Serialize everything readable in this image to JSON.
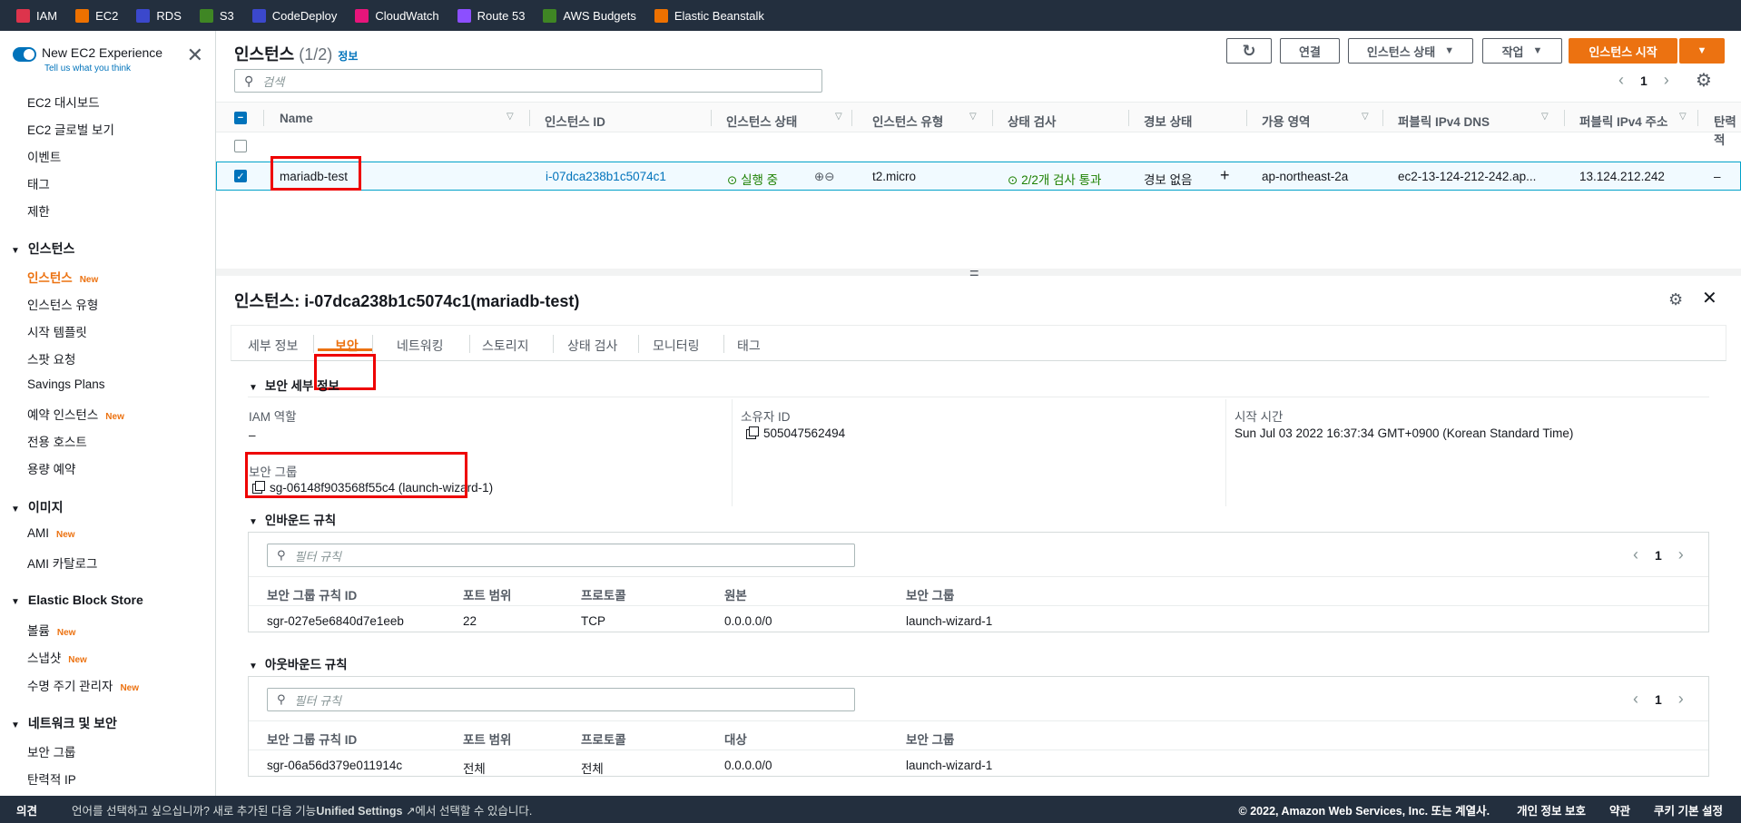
{
  "favorites": [
    {
      "label": "IAM",
      "icon": "iam-icon",
      "color": "#dd344c"
    },
    {
      "label": "EC2",
      "icon": "ec2-icon",
      "color": "#ed7100"
    },
    {
      "label": "RDS",
      "icon": "rds-icon",
      "color": "#3b48cc"
    },
    {
      "label": "S3",
      "icon": "s3-icon",
      "color": "#3f8624"
    },
    {
      "label": "CodeDeploy",
      "icon": "codedeploy-icon",
      "color": "#3b48cc"
    },
    {
      "label": "CloudWatch",
      "icon": "cloudwatch-icon",
      "color": "#e7157b"
    },
    {
      "label": "Route 53",
      "icon": "route53-icon",
      "color": "#8c4fff"
    },
    {
      "label": "AWS Budgets",
      "icon": "budgets-icon",
      "color": "#3f8624"
    },
    {
      "label": "Elastic Beanstalk",
      "icon": "beanstalk-icon",
      "color": "#ed7100"
    }
  ],
  "sidebar": {
    "experience_title": "New EC2 Experience",
    "experience_link": "Tell us what you think",
    "new_badge": "New",
    "top_items": [
      "EC2 대시보드",
      "EC2 글로벌 보기",
      "이벤트",
      "태그",
      "제한"
    ],
    "sections": [
      {
        "title": "인스턴스",
        "items": [
          {
            "label": "인스턴스",
            "new": true,
            "active": true
          },
          {
            "label": "인스턴스 유형"
          },
          {
            "label": "시작 템플릿"
          },
          {
            "label": "스팟 요청"
          },
          {
            "label": "Savings Plans"
          },
          {
            "label": "예약 인스턴스",
            "new": true
          },
          {
            "label": "전용 호스트"
          },
          {
            "label": "용량 예약"
          }
        ]
      },
      {
        "title": "이미지",
        "items": [
          {
            "label": "AMI",
            "new": true
          },
          {
            "label": "AMI 카탈로그"
          }
        ]
      },
      {
        "title": "Elastic Block Store",
        "items": [
          {
            "label": "볼륨",
            "new": true
          },
          {
            "label": "스냅샷",
            "new": true
          },
          {
            "label": "수명 주기 관리자",
            "new": true
          }
        ]
      },
      {
        "title": "네트워크 및 보안",
        "items": [
          {
            "label": "보안 그룹"
          },
          {
            "label": "탄력적 IP"
          }
        ]
      }
    ]
  },
  "instances": {
    "title": "인스턴스",
    "count": "(1/2)",
    "info": "정보",
    "buttons": {
      "connect": "연결",
      "state": "인스턴스 상태",
      "actions": "작업",
      "launch": "인스턴스 시작"
    },
    "search_placeholder": "검색",
    "page": "1",
    "columns": [
      "Name",
      "인스턴스 ID",
      "인스턴스 상태",
      "인스턴스 유형",
      "상태 검사",
      "경보 상태",
      "가용 영역",
      "퍼블릭 IPv4 DNS",
      "퍼블릭 IPv4 주소",
      "탄력적"
    ],
    "selected_row": {
      "name": "mariadb-test",
      "id": "i-07dca238b1c5074c1",
      "state": "실행 중",
      "type": "t2.micro",
      "checks": "2/2개 검사 통과",
      "alarm": "경보 없음",
      "az": "ap-northeast-2a",
      "dns": "ec2-13-124-212-242.ap...",
      "ip": "13.124.212.242",
      "eip": "–"
    }
  },
  "detail": {
    "title": "인스턴스: i-07dca238b1c5074c1(mariadb-test)",
    "tabs": [
      "세부 정보",
      "보안",
      "네트워킹",
      "스토리지",
      "상태 검사",
      "모니터링",
      "태그"
    ],
    "active_tab": "보안",
    "security_section": "보안 세부 정보",
    "iam_role_label": "IAM 역할",
    "iam_role_value": "–",
    "owner_label": "소유자 ID",
    "owner_value": "505047562494",
    "launch_label": "시작 시간",
    "launch_value": "Sun Jul 03 2022 16:37:34 GMT+0900 (Korean Standard Time)",
    "sg_label": "보안 그룹",
    "sg_value": "sg-06148f903568f55c4 (launch-wizard-1)",
    "inbound": {
      "title": "인바운드 규칙",
      "filter": "필터 규칙",
      "page": "1",
      "columns": [
        "보안 그룹 규칙 ID",
        "포트 범위",
        "프로토콜",
        "원본",
        "보안 그룹"
      ],
      "row": [
        "sgr-027e5e6840d7e1eeb",
        "22",
        "TCP",
        "0.0.0.0/0",
        "launch-wizard-1"
      ]
    },
    "outbound": {
      "title": "아웃바운드 규칙",
      "filter": "필터 규칙",
      "page": "1",
      "columns": [
        "보안 그룹 규칙 ID",
        "포트 범위",
        "프로토콜",
        "대상",
        "보안 그룹"
      ],
      "row": [
        "sgr-06a56d379e011914c",
        "전체",
        "전체",
        "0.0.0.0/0",
        "launch-wizard-1"
      ]
    }
  },
  "footer": {
    "feedback": "의견",
    "lang_prefix": "언어를 선택하고 싶으십니까? 새로 추가된 다음 기능",
    "unified": "Unified Settings",
    "lang_suffix": "에서 선택할 수 있습니다.",
    "copyright": "© 2022, Amazon Web Services, Inc. 또는 계열사.",
    "privacy": "개인 정보 보호",
    "terms": "약관",
    "cookies": "쿠키 기본 설정"
  }
}
